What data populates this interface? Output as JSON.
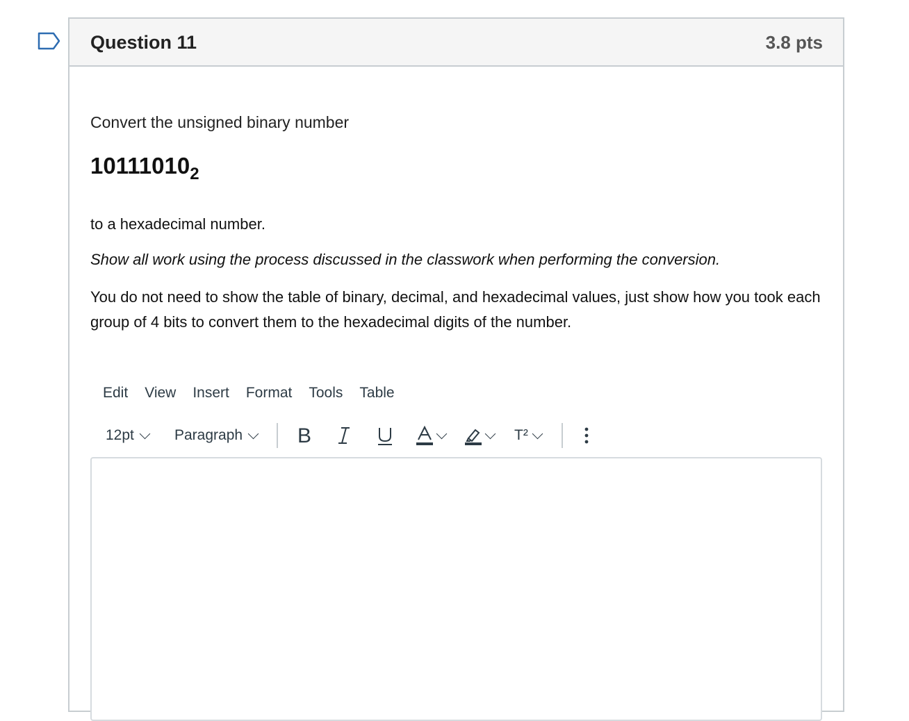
{
  "question": {
    "title": "Question 11",
    "points": "3.8 pts"
  },
  "content": {
    "prompt": "Convert the unsigned binary number",
    "binary_number": "10111010",
    "binary_base": "2",
    "line_1": "to a hexadecimal number.",
    "line_2": "Show all work using the process discussed in the classwork when performing the conversion.",
    "line_3": "You do not need to show the table of binary, decimal, and hexadecimal values, just show how you took each group of 4 bits to convert them to the hexadecimal digits of the number."
  },
  "editor": {
    "menu": [
      "Edit",
      "View",
      "Insert",
      "Format",
      "Tools",
      "Table"
    ],
    "toolbar": {
      "font_size": "12pt",
      "block_format": "Paragraph",
      "superscript_label": "T²"
    },
    "value": ""
  },
  "icons": {
    "flag": "flag-outline-icon",
    "bold": "bold-icon",
    "italic": "italic-icon",
    "underline": "underline-icon",
    "text_color": "text-color-icon",
    "highlight": "highlight-icon",
    "superscript": "superscript-icon",
    "more": "more-options-icon"
  },
  "colors": {
    "border": "#c7cdd1",
    "header_bg": "#f5f5f5",
    "icon": "#2d3b45"
  }
}
